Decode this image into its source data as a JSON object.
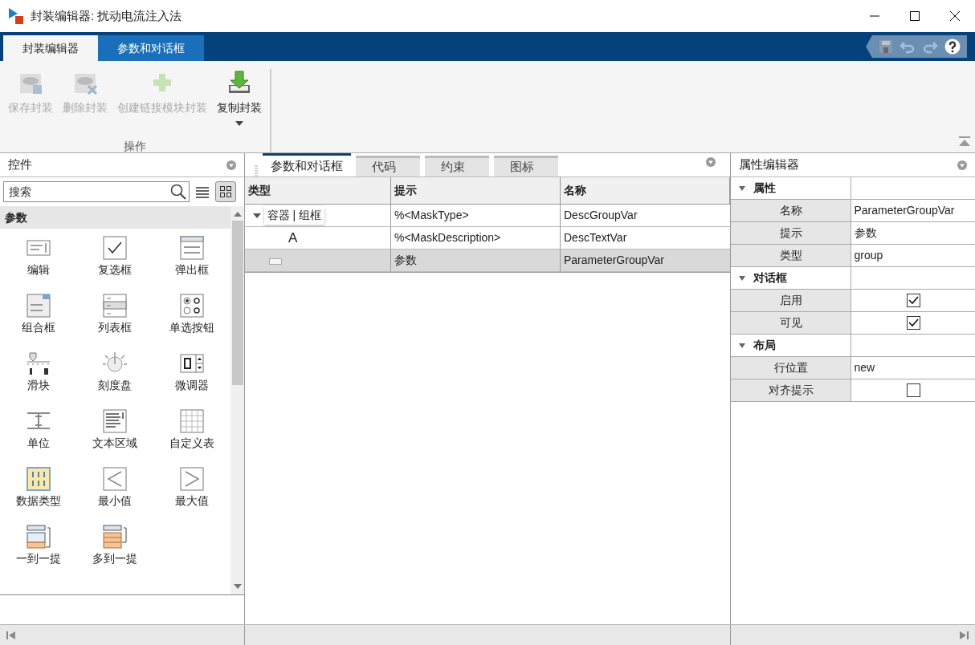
{
  "window": {
    "title": "封装编辑器: 扰动电流注入法"
  },
  "ribbon_tabs": [
    {
      "label": "封装编辑器",
      "selected": true
    },
    {
      "label": "参数和对话框",
      "selected": false
    }
  ],
  "toolbar": {
    "group_label": "操作",
    "buttons": [
      {
        "label": "保存封装",
        "kind": "save",
        "disabled": true,
        "dropdown": false
      },
      {
        "label": "删除封装",
        "kind": "delete",
        "disabled": true,
        "dropdown": false
      },
      {
        "label": "创建链接模块封装",
        "kind": "create",
        "disabled": true,
        "dropdown": false
      },
      {
        "label": "复制封装",
        "kind": "copy",
        "disabled": false,
        "dropdown": true
      }
    ]
  },
  "controls_panel": {
    "title": "控件",
    "search": {
      "placeholder": "搜索"
    },
    "section": "参数",
    "items": [
      {
        "label": "编辑",
        "kind": "edit"
      },
      {
        "label": "复选框",
        "kind": "checkbox"
      },
      {
        "label": "弹出框",
        "kind": "popup"
      },
      {
        "label": "组合框",
        "kind": "combobox"
      },
      {
        "label": "列表框",
        "kind": "listbox"
      },
      {
        "label": "单选按钮",
        "kind": "radio"
      },
      {
        "label": "滑块",
        "kind": "slider"
      },
      {
        "label": "刻度盘",
        "kind": "dial"
      },
      {
        "label": "微调器",
        "kind": "spinner"
      },
      {
        "label": "单位",
        "kind": "unit"
      },
      {
        "label": "文本区域",
        "kind": "textarea"
      },
      {
        "label": "自定义表",
        "kind": "table"
      },
      {
        "label": "数据类型",
        "kind": "datatype"
      },
      {
        "label": "最小值",
        "kind": "min"
      },
      {
        "label": "最大值",
        "kind": "max"
      },
      {
        "label": "一到一提",
        "kind": "promote-one"
      },
      {
        "label": "多到一提",
        "kind": "promote-many"
      }
    ]
  },
  "editor_tabs": [
    {
      "label": "参数和对话框",
      "selected": true
    },
    {
      "label": "代码",
      "selected": false
    },
    {
      "label": "约束",
      "selected": false
    },
    {
      "label": "图标",
      "selected": false
    }
  ],
  "table": {
    "columns": [
      "类型",
      "提示",
      "名称"
    ],
    "rows": [
      {
        "kind": "container",
        "type": "容器 | 组框",
        "expanded": true,
        "prompt": "%<MaskType>",
        "name": "DescGroupVar",
        "selected": false
      },
      {
        "kind": "text",
        "type": "A",
        "prompt": "%<MaskDescription>",
        "name": "DescTextVar",
        "selected": false
      },
      {
        "kind": "group",
        "prompt": "参数",
        "name": "ParameterGroupVar",
        "selected": true
      }
    ]
  },
  "property_editor": {
    "title": "属性编辑器",
    "sections": [
      {
        "title": "属性",
        "expanded": true,
        "rows": [
          {
            "label": "名称",
            "kind": "text",
            "value": "ParameterGroupVar"
          },
          {
            "label": "提示",
            "kind": "text",
            "value": "参数"
          },
          {
            "label": "类型",
            "kind": "text",
            "value": "group"
          }
        ]
      },
      {
        "title": "对话框",
        "expanded": true,
        "rows": [
          {
            "label": "启用",
            "kind": "check",
            "checked": true
          },
          {
            "label": "可见",
            "kind": "check",
            "checked": true
          }
        ]
      },
      {
        "title": "布局",
        "expanded": true,
        "rows": [
          {
            "label": "行位置",
            "kind": "text",
            "value": "new"
          },
          {
            "label": "对齐提示",
            "kind": "check",
            "checked": false
          }
        ]
      }
    ]
  }
}
